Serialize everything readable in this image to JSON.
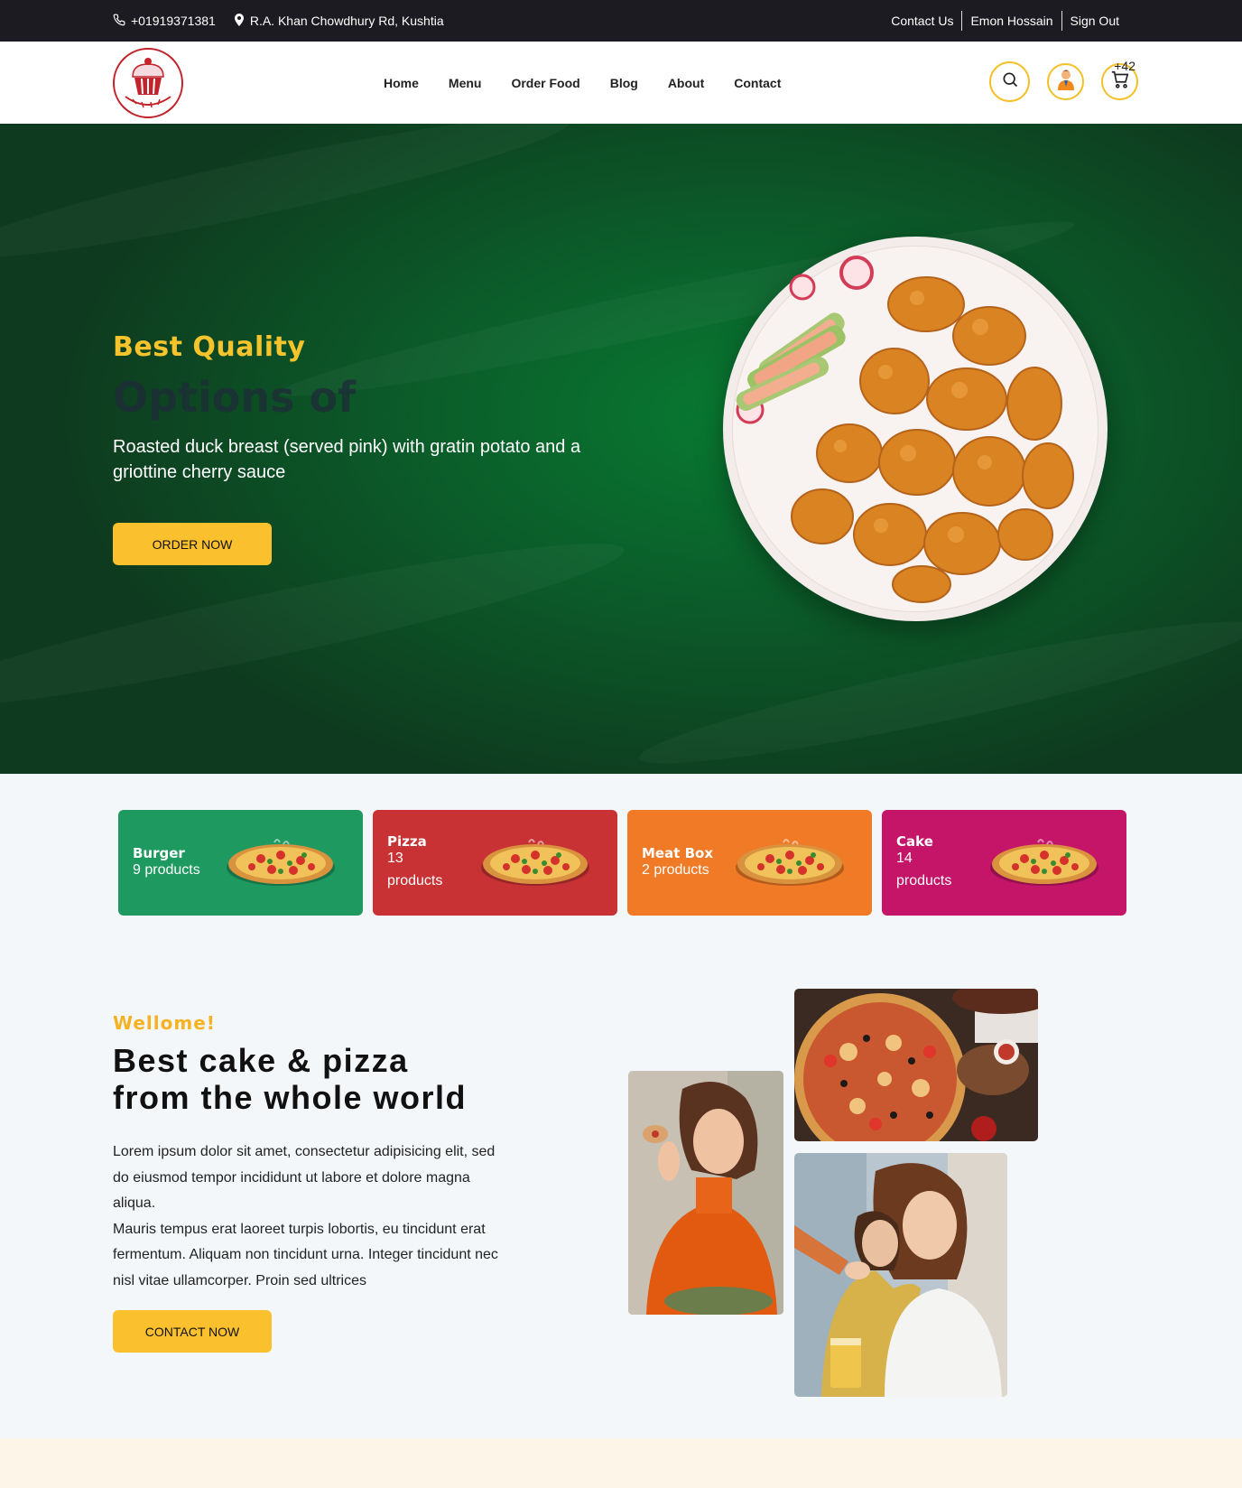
{
  "topbar": {
    "phone": "+01919371381",
    "address": "R.A. Khan Chowdhury Rd, Kushtia",
    "links": [
      "Contact Us",
      "Emon Hossain",
      "Sign Out"
    ]
  },
  "header": {
    "logo_text": "The Cake Stand",
    "nav": [
      "Home",
      "Menu",
      "Order Food",
      "Blog",
      "About",
      "Contact"
    ],
    "cart_count": "+42"
  },
  "hero": {
    "eyebrow": "Best Quality",
    "faded_title": "Options of",
    "description": "Roasted duck breast (served pink) with gratin potato and a griottine cherry sauce",
    "button": "ORDER NOW"
  },
  "categories": [
    {
      "name": "Burger",
      "count": "9 products",
      "color": "#1e9960"
    },
    {
      "name": "Pizza",
      "count": "13 products",
      "color": "#c83235"
    },
    {
      "name": "Meat Box",
      "count": "2 products",
      "color": "#f07a26"
    },
    {
      "name": "Cake",
      "count": "14 products",
      "color": "#c41569"
    }
  ],
  "welcome": {
    "eyebrow": "Wellome!",
    "title_line1": "Best cake & pizza",
    "title_line2": "from the whole world",
    "para1": "Lorem ipsum dolor sit amet, consectetur adipisicing elit, sed do eiusmod tempor incididunt ut labore et dolore magna aliqua.",
    "para2": "Mauris tempus erat laoreet turpis lobortis, eu tincidunt erat fermentum. Aliquam non tincidunt urna. Integer tincidunt nec nisl vitae ullamcorper. Proin sed ultrices",
    "button": "CONTACT NOW"
  },
  "colors": {
    "accent": "#fbc02d",
    "topbar": "#1b1b21",
    "hero_green": "#0b5e2a"
  }
}
